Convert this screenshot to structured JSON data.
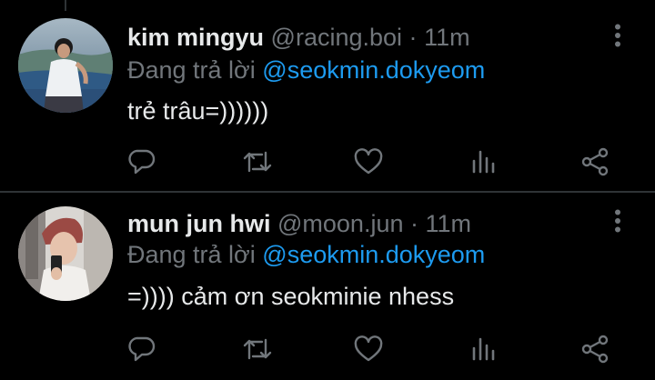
{
  "colors": {
    "background": "#000000",
    "primary_text": "#e7e9ea",
    "secondary_text": "#71767b",
    "link": "#1d9bf0",
    "divider": "#2f3336"
  },
  "tweets": [
    {
      "name": "kim mingyu",
      "handle": "@racing.boi",
      "separator": "·",
      "time": "11m",
      "reply_prefix": "Đang trả lời",
      "reply_to": "@seokmin.dokyeom",
      "text": "trẻ trâu=))))))",
      "avatar": "profile-photo",
      "actions": [
        "reply-icon",
        "retweet-icon",
        "like-icon",
        "views-icon",
        "share-icon"
      ]
    },
    {
      "name": "mun jun hwi",
      "handle": "@moon.jun",
      "separator": "·",
      "time": "11m",
      "reply_prefix": "Đang trả lời",
      "reply_to": "@seokmin.dokyeom",
      "text": "=)))) cảm ơn seokminie nhess",
      "avatar": "profile-photo",
      "actions": [
        "reply-icon",
        "retweet-icon",
        "like-icon",
        "views-icon",
        "share-icon"
      ]
    }
  ]
}
